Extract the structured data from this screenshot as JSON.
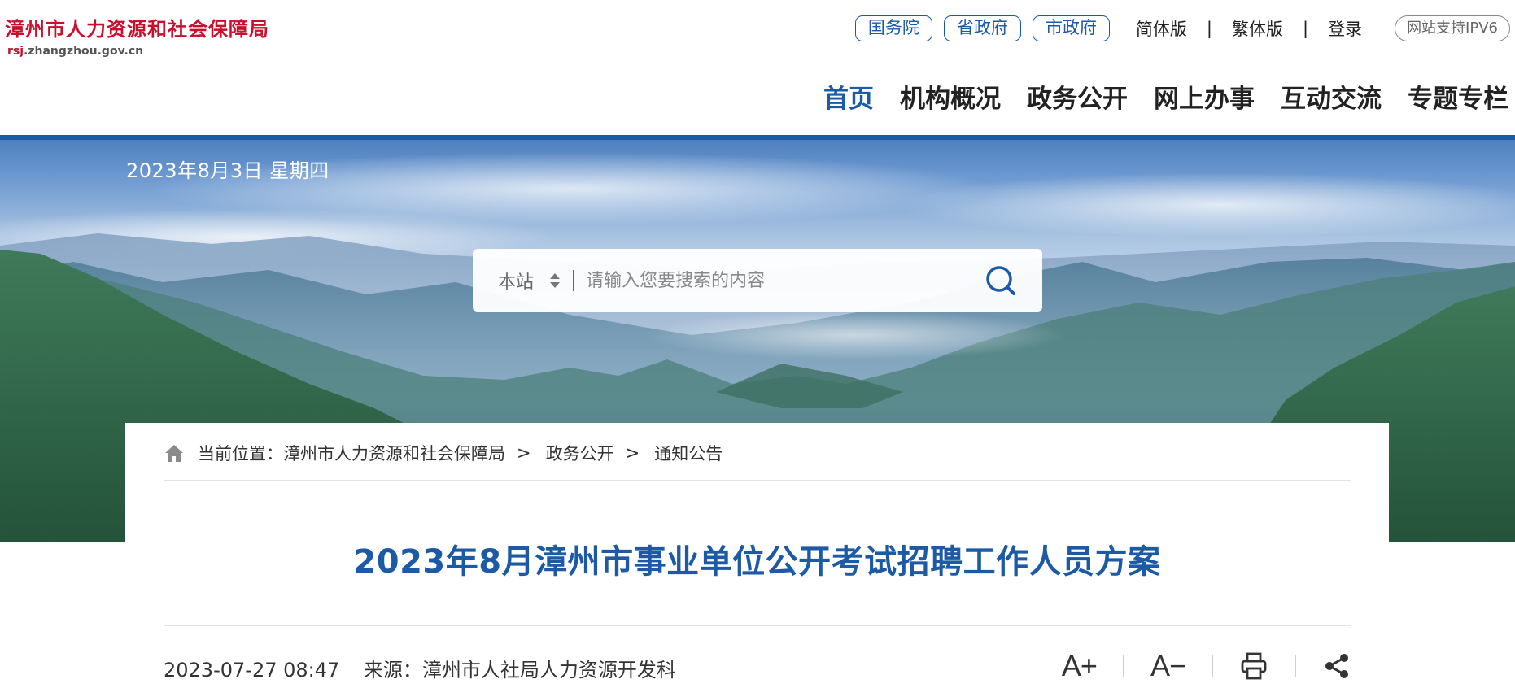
{
  "header": {
    "site_name": "漳州市人力资源和社会保障局",
    "site_url_prefix": "rsj",
    "site_url_rest": ".zhangzhou.gov.cn",
    "top_links": [
      "国务院",
      "省政府",
      "市政府"
    ],
    "lang_simplified": "简体版",
    "lang_traditional": "繁体版",
    "separator": "|",
    "login": "登录",
    "ipv6_badge": "网站支持IPV6",
    "nav": [
      {
        "label": "首页",
        "active": true
      },
      {
        "label": "机构概况",
        "active": false
      },
      {
        "label": "政务公开",
        "active": false
      },
      {
        "label": "网上办事",
        "active": false
      },
      {
        "label": "互动交流",
        "active": false
      },
      {
        "label": "专题专栏",
        "active": false
      }
    ]
  },
  "banner": {
    "date": "2023年8月3日 星期四",
    "search": {
      "scope": "本站",
      "placeholder": "请输入您要搜索的内容"
    }
  },
  "breadcrumb": {
    "prefix": "当前位置：",
    "items": [
      "漳州市人力资源和社会保障局",
      "政务公开",
      "通知公告"
    ],
    "separator": ">"
  },
  "article": {
    "title": "2023年8月漳州市事业单位公开考试招聘工作人员方案",
    "datetime": "2023-07-27 08:47",
    "source": "来源：漳州市人社局人力资源开发科",
    "tools": {
      "font_increase": "A+",
      "font_decrease": "A−"
    }
  },
  "colors": {
    "brand_blue": "#1c5aa6",
    "logo_red": "#c8102e"
  },
  "icons": [
    "home-icon",
    "search-icon",
    "sort-arrows-icon",
    "print-icon",
    "share-icon"
  ]
}
